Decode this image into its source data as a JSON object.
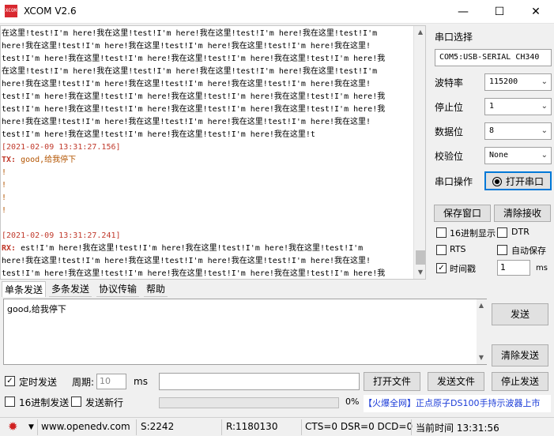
{
  "window": {
    "icon_text": "XCOM",
    "title": "XCOM V2.6",
    "minimize": "—",
    "maximize": "☐",
    "close": "✕"
  },
  "receive": {
    "lines": [
      {
        "kind": "text",
        "text": "在这里!test!I'm here!我在这里!test!I'm here!我在这里!test!I'm here!我在这里!test!I'm"
      },
      {
        "kind": "text",
        "text": "here!我在这里!test!I'm here!我在这里!test!I'm here!我在这里!test!I'm here!我在这里!"
      },
      {
        "kind": "text",
        "text": "test!I'm here!我在这里!test!I'm here!我在这里!test!I'm here!我在这里!test!I'm here!我"
      },
      {
        "kind": "text",
        "text": "在这里!test!I'm here!我在这里!test!I'm here!我在这里!test!I'm here!我在这里!test!I'm"
      },
      {
        "kind": "text",
        "text": "here!我在这里!test!I'm here!我在这里!test!I'm here!我在这里!test!I'm here!我在这里!"
      },
      {
        "kind": "text",
        "text": "test!I'm here!我在这里!test!I'm here!我在这里!test!I'm here!我在这里!test!I'm here!我"
      },
      {
        "kind": "text",
        "text": "test!I'm here!我在这里!test!I'm here!我在这里!test!I'm here!我在这里!test!I'm here!我"
      },
      {
        "kind": "text",
        "text": "here!我在这里!test!I'm here!我在这里!test!I'm here!我在这里!test!I'm here!我在这里!"
      },
      {
        "kind": "text",
        "text": "test!I'm here!我在这里!test!I'm here!我在这里!test!I'm here!我在这里!t"
      },
      {
        "kind": "ts",
        "text": "[2021-02-09 13:31:27.156]"
      },
      {
        "kind": "tx",
        "label": "TX:",
        "text": " good,给我停下"
      },
      {
        "kind": "tx",
        "text": "!"
      },
      {
        "kind": "tx",
        "text": "!"
      },
      {
        "kind": "tx",
        "text": "!"
      },
      {
        "kind": "tx",
        "text": "!"
      },
      {
        "kind": "blank",
        "text": ""
      },
      {
        "kind": "ts",
        "text": "[2021-02-09 13:31:27.241]"
      },
      {
        "kind": "rx",
        "label": "RX:",
        "text": " est!I'm here!我在这里!test!I'm here!我在这里!test!I'm here!我在这里!test!I'm"
      },
      {
        "kind": "text",
        "text": "here!我在这里!test!I'm here!我在这里!test!I'm here!我在这里!test!I'm here!我在这里!"
      },
      {
        "kind": "text",
        "text": "test!I'm here!我在这里!test!I'm here!我在这里!test!I'm here!我在这里!test!I'm here!我"
      }
    ]
  },
  "settings": {
    "port_label": "串口选择",
    "port_value": "COM5:USB-SERIAL CH340",
    "baud_label": "波特率",
    "baud_value": "115200",
    "stopbit_label": "停止位",
    "stopbit_value": "1",
    "databit_label": "数据位",
    "databit_value": "8",
    "parity_label": "校验位",
    "parity_value": "None",
    "op_label": "串口操作",
    "open_button": "打开串口",
    "save_window": "保存窗口",
    "clear_receive": "清除接收",
    "hex_display": "16进制显示",
    "dtr": "DTR",
    "rts": "RTS",
    "auto_save": "自动保存",
    "timestamp": "时间戳",
    "timestamp_checked": true,
    "timestamp_ms": "1",
    "ms_unit": "ms"
  },
  "tabs": [
    "单条发送",
    "多条发送",
    "协议传输",
    "帮助"
  ],
  "send": {
    "text": "good,给我停下",
    "send_button": "发送",
    "clear_send_button": "清除发送"
  },
  "bottom": {
    "timed_send": "定时发送",
    "timed_send_checked": true,
    "period_label": "周期:",
    "period_value": "10",
    "period_unit": "ms",
    "hex_send": "16进制发送",
    "send_newline": "发送新行",
    "progress_text": "0%",
    "open_file": "打开文件",
    "send_file": "发送文件",
    "stop_send": "停止发送",
    "ad_text": "【火爆全网】正点原子DS100手持示波器上市"
  },
  "status": {
    "url": "www.openedv.com",
    "sent": "S:2242",
    "received": "R:1180130",
    "lines": "CTS=0 DSR=0 DCD=0",
    "time": "当前时间 13:31:56"
  }
}
